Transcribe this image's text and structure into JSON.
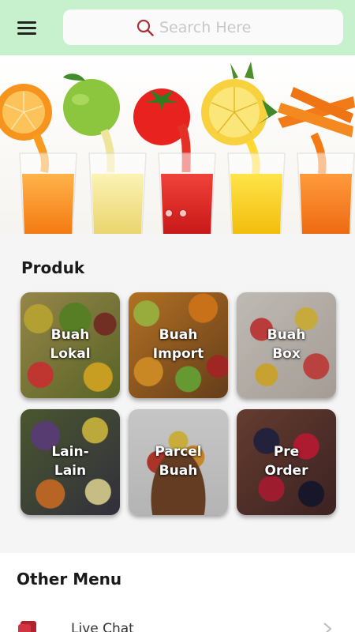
{
  "search": {
    "placeholder": "Search Here"
  },
  "produk": {
    "title": "Produk",
    "items": [
      {
        "label": "Buah\nLokal"
      },
      {
        "label": "Buah\nImport"
      },
      {
        "label": "Buah\nBox"
      },
      {
        "label": "Lain-\nLain"
      },
      {
        "label": "Parcel\nBuah"
      },
      {
        "label": "Pre\nOrder"
      }
    ]
  },
  "other_menu": {
    "title": "Other Menu",
    "items": [
      {
        "label": "Live Chat",
        "icon": "chat-icon"
      }
    ]
  },
  "colors": {
    "header_bg": "#c7f0cd",
    "search_icon": "#a8323a",
    "chat_icon": "#b0222e"
  }
}
